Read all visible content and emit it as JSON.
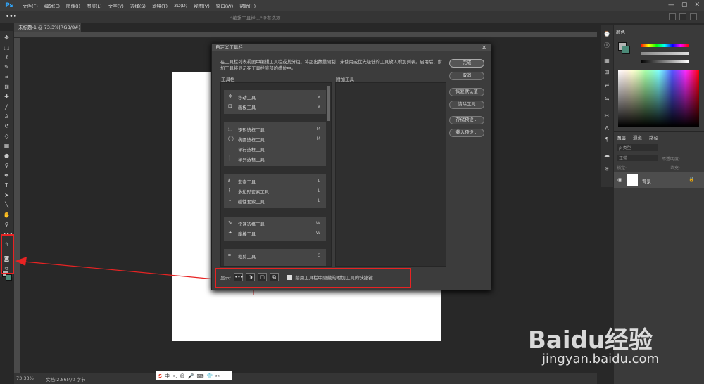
{
  "app": {
    "logo": "Ps",
    "menus": [
      "文件(F)",
      "编辑(E)",
      "图像(I)",
      "图层(L)",
      "文字(Y)",
      "选择(S)",
      "滤镜(T)",
      "3D(D)",
      "视图(V)",
      "窗口(W)",
      "帮助(H)"
    ],
    "window_controls": [
      "—",
      "▢",
      "✕"
    ]
  },
  "options_bar": {
    "hint": "“编辑工具栏...”没有选项"
  },
  "document": {
    "tab_title": "未标题-1 @ 73.3%(RGB/8#)",
    "zoom": "73.33%",
    "doc_size": "文档:2.86M/0 字节"
  },
  "dialog": {
    "title": "自定义工具栏",
    "close": "✕",
    "description": "在工具栏列表视图中编辑工具栏或其分组。将超出数量限制、未使用或优先级低的工具放入附加列表。启用后，附加工具将显示在工具栏底部的槽位中。",
    "toolbar_heading": "工具栏",
    "extra_heading": "附加工具",
    "groups": [
      [
        {
          "icon": "✥",
          "label": "移动工具",
          "key": "V"
        },
        {
          "icon": "⊡",
          "label": "画板工具",
          "key": "V"
        }
      ],
      [
        {
          "icon": "⬚",
          "label": "矩形选框工具",
          "key": "M"
        },
        {
          "icon": "◯",
          "label": "椭圆选框工具",
          "key": "M"
        },
        {
          "icon": "┄",
          "label": "单行选框工具",
          "key": ""
        },
        {
          "icon": "┆",
          "label": "单列选框工具",
          "key": ""
        }
      ],
      [
        {
          "icon": "ℓ",
          "label": "套索工具",
          "key": "L"
        },
        {
          "icon": "⌇",
          "label": "多边形套索工具",
          "key": "L"
        },
        {
          "icon": "⌁",
          "label": "磁性套索工具",
          "key": "L"
        }
      ],
      [
        {
          "icon": "✎",
          "label": "快速选择工具",
          "key": "W"
        },
        {
          "icon": "✦",
          "label": "魔棒工具",
          "key": "W"
        }
      ],
      [
        {
          "icon": "⌗",
          "label": "裁剪工具",
          "key": "C"
        }
      ]
    ],
    "buttons": {
      "done": "完成",
      "cancel": "取消",
      "restore": "恢复默认值",
      "clear": "清除工具",
      "save": "存储预设...",
      "load": "载入预设..."
    },
    "show_label": "显示:",
    "show_icons": [
      "•••",
      "◑",
      "▢",
      "⧉"
    ],
    "checkbox_label": "禁用工具栏中隐藏的附加工具的快捷键"
  },
  "panels": {
    "color_tab": "颜色",
    "layers_tabs": [
      "图层",
      "通道",
      "路径"
    ],
    "layer_kind": "ρ 类型",
    "blend_mode": "正常",
    "opacity_label": "不透明度:",
    "lock_label": "锁定:",
    "fill_label": "填充:",
    "layer_name": "背景"
  },
  "ime": {
    "label": "中",
    "icons": [
      "•,",
      "☺",
      "🎤",
      "⌨",
      "👕",
      "✂"
    ]
  },
  "watermark": {
    "brand": "Baidu经验",
    "url": "jingyan.baidu.com"
  },
  "colors": {
    "highlight": "#e82323",
    "foreground": "#b4b4b4",
    "background": "#4b8a78"
  }
}
